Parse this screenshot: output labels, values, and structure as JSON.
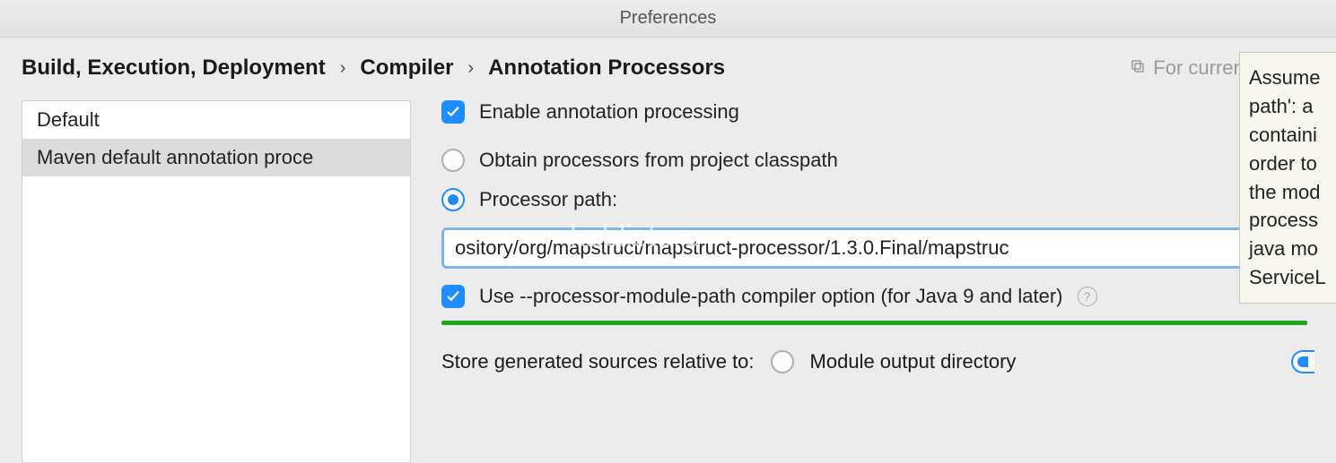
{
  "window": {
    "title": "Preferences"
  },
  "breadcrumb": {
    "item1": "Build, Execution, Deployment",
    "item2": "Compiler",
    "item3": "Annotation Processors"
  },
  "scope": {
    "label": "For current project"
  },
  "sidebar": {
    "items": [
      {
        "label": "Default"
      },
      {
        "label": "Maven default annotation proce"
      }
    ]
  },
  "options": {
    "enable_label": "Enable annotation processing",
    "enable_checked": true,
    "obtain_label": "Obtain processors from project classpath",
    "obtain_checked": false,
    "processor_path_label": "Processor path:",
    "processor_path_checked": true,
    "processor_path_value": "ository/org/mapstruct/mapstruct-processor/1.3.0.Final/mapstruc",
    "module_path_label": "Use --processor-module-path compiler option (for Java 9 and later)",
    "module_path_checked": true,
    "store_label": "Store generated sources relative to:",
    "store_option1": "Module output directory",
    "store_option1_checked": false
  },
  "tooltip": {
    "l1": "Assume",
    "l2": "path': a",
    "l3": "containi",
    "l4": "order to",
    "l5": "the mod",
    "l6": "process",
    "l7": "java mo",
    "l8": "ServiceL"
  },
  "watermark": "kablistore"
}
